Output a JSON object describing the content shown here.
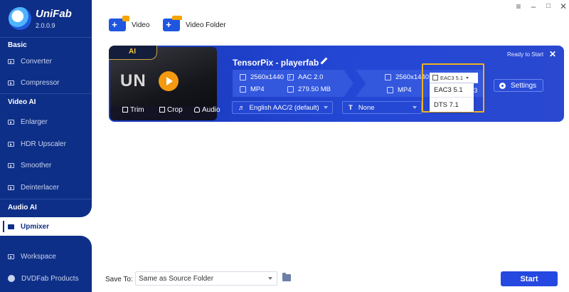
{
  "app": {
    "name": "UniFab",
    "version": "2.0.0.9"
  },
  "sidebar": {
    "sections": {
      "basic": "Basic",
      "video_ai": "Video AI",
      "audio_ai": "Audio AI"
    },
    "items": {
      "converter": "Converter",
      "compressor": "Compressor",
      "enlarger": "Enlarger",
      "hdr_upscaler": "HDR Upscaler",
      "smoother": "Smoother",
      "deinterlacer": "Deinterlacer",
      "upmixer": "Upmixer",
      "workspace": "Workspace",
      "dvdfab_products": "DVDFab Products"
    }
  },
  "toolbar": {
    "add_video": "Video",
    "add_folder": "Video Folder"
  },
  "task": {
    "badge": "AI",
    "thumb_text": "UN",
    "title": "TensorPix - playerfab",
    "status": "Ready to Start",
    "tools": {
      "trim": "Trim",
      "crop": "Crop",
      "audio": "Audio"
    },
    "source": {
      "resolution": "2560x1440",
      "audio": "AAC 2.0",
      "format": "MP4",
      "size": "279.50 MB"
    },
    "output": {
      "resolution": "2560x1440",
      "format": "MP4",
      "truncated_digit": "3"
    },
    "audio_track": "English AAC/2 (default)",
    "subtitle": "None",
    "settings_label": "Settings",
    "audio_popup": {
      "selected": "EAC3 5.1",
      "options": [
        "EAC3 5.1",
        "DTS 7.1"
      ]
    }
  },
  "footer": {
    "save_to_label": "Save To:",
    "save_to_value": "Same as Source Folder",
    "start_label": "Start"
  },
  "colors": {
    "sidebar_bg": "#0e2f87",
    "card_bg": "#2447d6",
    "accent_orange": "#f0b21f",
    "start_btn": "#2448e0"
  }
}
